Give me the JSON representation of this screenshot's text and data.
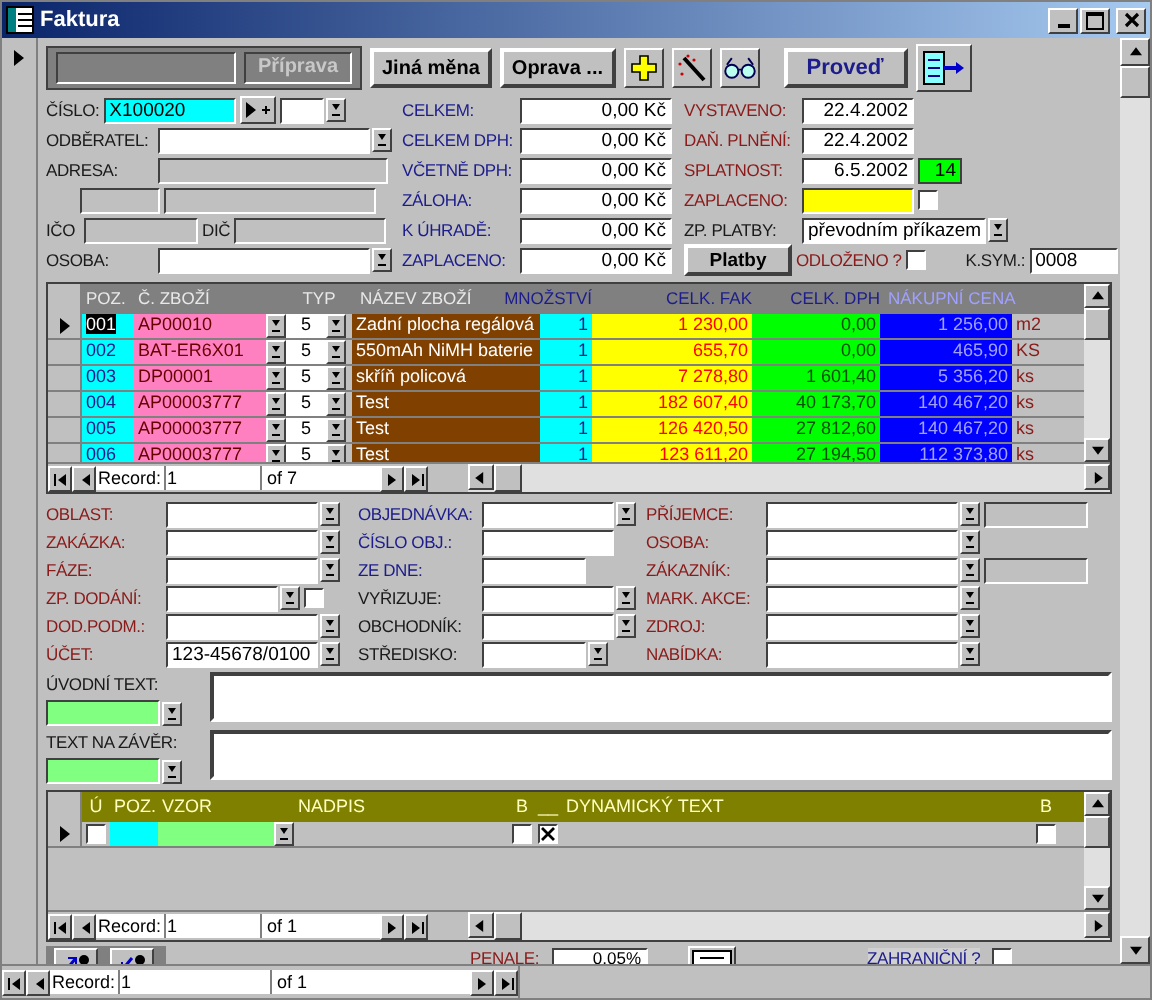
{
  "window": {
    "title": "Faktura"
  },
  "header": {
    "stage": "Příprava",
    "buttons": [
      {
        "label": "Jiná měna"
      },
      {
        "label": "Oprava ..."
      }
    ],
    "run_button": "Proveď"
  },
  "document": {
    "fields": [
      {
        "label": "ČÍSLO:",
        "value": "X100020"
      },
      {
        "label": "ODBĚRATEL:"
      },
      {
        "label": "ADRESA:"
      },
      {
        "label": "IČO"
      },
      {
        "label": "DIČ"
      },
      {
        "label": "OSOBA:"
      }
    ]
  },
  "totals": [
    {
      "label": "CELKEM:",
      "value": "0,00 Kč"
    },
    {
      "label": "CELKEM DPH:",
      "value": "0,00 Kč"
    },
    {
      "label": "VČETNĚ DPH:",
      "value": "0,00 Kč"
    },
    {
      "label": "ZÁLOHA:",
      "value": "0,00 Kč"
    },
    {
      "label": "K ÚHRADĚ:",
      "value": "0,00 Kč"
    },
    {
      "label": "ZAPLACENO:",
      "value": "0,00 Kč"
    }
  ],
  "dates": [
    {
      "label": "VYSTAVENO:",
      "value": "22.4.2002"
    },
    {
      "label": "DAŇ. PLNĚNÍ:",
      "value": "22.4.2002"
    },
    {
      "label": "SPLATNOST:",
      "value": "6.5.2002",
      "days": "14"
    },
    {
      "label": "ZAPLACENO:",
      "checked": false
    }
  ],
  "payment": {
    "label": "ZP. PLATBY:",
    "value": "převodním příkazem"
  },
  "payments_button": "Platby",
  "deferred": {
    "label": "ODLOŽENO ?",
    "checked": false
  },
  "variable_symbol": {
    "label": "K.SYM.:",
    "value": "0008"
  },
  "items": {
    "columns": [
      "POZ.",
      "Č. ZBOŽÍ",
      "TYP",
      "NÁZEV ZBOŽÍ",
      "MNOŽSTVÍ",
      "CELK. FAK",
      "CELK. DPH",
      "NÁKUPNÍ CENA"
    ],
    "rows": [
      {
        "poz": "001",
        "code": "AP00010",
        "type": "5",
        "name": "Zadní plocha regálová",
        "qty": "1",
        "total": "1 230,00",
        "vat": "0,00",
        "cost": "1 256,00",
        "unit": "m2",
        "selected": true
      },
      {
        "poz": "002",
        "code": "BAT-ER6X01",
        "type": "5",
        "name": "550mAh NiMH baterie",
        "qty": "1",
        "total": "655,70",
        "vat": "0,00",
        "cost": "465,90",
        "unit": "KS",
        "selected": false
      },
      {
        "poz": "003",
        "code": "DP00001",
        "type": "5",
        "name": "skříň policová",
        "qty": "1",
        "total": "7 278,80",
        "vat": "1 601,40",
        "cost": "5 356,20",
        "unit": "ks",
        "selected": false
      },
      {
        "poz": "004",
        "code": "AP00003777",
        "type": "5",
        "name": "Test",
        "qty": "1",
        "total": "182 607,40",
        "vat": "40 173,70",
        "cost": "140 467,20",
        "unit": "ks",
        "selected": false
      },
      {
        "poz": "005",
        "code": "AP00003777",
        "type": "5",
        "name": "Test",
        "qty": "1",
        "total": "126 420,50",
        "vat": "27 812,60",
        "cost": "140 467,20",
        "unit": "ks",
        "selected": false
      },
      {
        "poz": "006",
        "code": "AP00003777",
        "type": "5",
        "name": "Test",
        "qty": "1",
        "total": "123 611,20",
        "vat": "27 194,50",
        "cost": "112 373,80",
        "unit": "ks",
        "selected": false
      }
    ],
    "navigator": {
      "label": "Record:",
      "current": "1",
      "total": "of 7"
    }
  },
  "details": [
    {
      "fields": [
        {
          "label": "OBLAST:",
          "kind": "combo",
          "color": "#8b1a1a"
        },
        {
          "label": "ZAKÁZKA:",
          "kind": "combo",
          "color": "#8b1a1a"
        },
        {
          "label": "FÁZE:",
          "kind": "combo",
          "color": "#8b1a1a"
        },
        {
          "label": "ZP. DODÁNÍ:",
          "kind": "combo-check",
          "color": "#8b1a1a",
          "checked": false
        },
        {
          "label": "DOD.PODM.:",
          "kind": "combo",
          "color": "#8b1a1a"
        },
        {
          "label": "ÚČET:",
          "kind": "combo",
          "color": "#8b1a1a",
          "value": "123-45678/0100"
        }
      ]
    },
    {
      "fields": [
        {
          "label": "OBJEDNÁVKA:",
          "kind": "combo",
          "color": "#1c1c8c"
        },
        {
          "label": "ČÍSLO OBJ.:",
          "kind": "text",
          "color": "#1c1c8c"
        },
        {
          "label": "ZE DNE:",
          "kind": "short-text",
          "color": "#1c1c8c"
        },
        {
          "label": "VYŘIZUJE:",
          "kind": "combo",
          "color": "#1a1a1a"
        },
        {
          "label": "OBCHODNÍK:",
          "kind": "combo",
          "color": "#1a1a1a"
        },
        {
          "label": "STŘEDISKO:",
          "kind": "short-combo",
          "color": "#1a1a1a"
        }
      ]
    },
    {
      "fields": [
        {
          "label": "PŘÍJEMCE:",
          "kind": "combo-extra",
          "color": "#8b1a1a"
        },
        {
          "label": "OSOBA:",
          "kind": "combo",
          "color": "#8b1a1a"
        },
        {
          "label": "ZÁKAZNÍK:",
          "kind": "combo-extra",
          "color": "#8b1a1a"
        },
        {
          "label": "MARK. AKCE:",
          "kind": "combo",
          "color": "#8b1a1a"
        },
        {
          "label": "ZDROJ:",
          "kind": "combo",
          "color": "#8b1a1a"
        },
        {
          "label": "NABÍDKA:",
          "kind": "combo",
          "color": "#8b1a1a"
        }
      ]
    }
  ],
  "texts": [
    {
      "label": "ÚVODNÍ TEXT:"
    },
    {
      "label": "TEXT NA ZÁVĚR:"
    }
  ],
  "paragraphs": {
    "columns": [
      "Ú",
      "POZ.",
      "VZOR",
      "NADPIS",
      "B",
      "__",
      "DYNAMICKÝ TEXT",
      "B"
    ],
    "rows": [
      {
        "selected": true,
        "u": false,
        "b": false,
        "line": true,
        "b2": false
      }
    ],
    "navigator": {
      "label": "Record:",
      "current": "1",
      "total": "of 1"
    }
  },
  "footer": {
    "penalty_label": "PENALE:",
    "penalty": "0,05%",
    "foreign": {
      "label": "ZAHRANIČNÍ ?",
      "checked": false
    }
  },
  "navigator": {
    "label": "Record:",
    "current": "1",
    "total": "of 1"
  }
}
